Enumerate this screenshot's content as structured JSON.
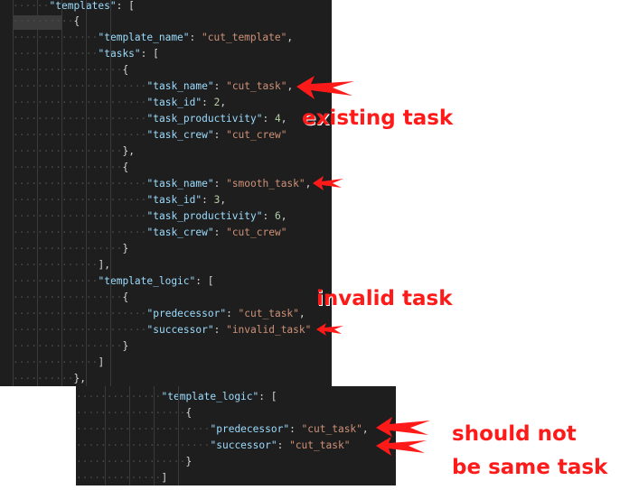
{
  "editor_top": {
    "lines": [
      [
        {
          "t": "\"templates\"",
          "c": "k"
        },
        {
          "t": ": [",
          "c": "p"
        }
      ],
      [
        {
          "t": "{",
          "c": "p"
        }
      ],
      [
        {
          "t": "\"template_name\"",
          "c": "k"
        },
        {
          "t": ": ",
          "c": "p"
        },
        {
          "t": "\"cut_template\"",
          "c": "s"
        },
        {
          "t": ",",
          "c": "p"
        }
      ],
      [
        {
          "t": "\"tasks\"",
          "c": "k"
        },
        {
          "t": ": [",
          "c": "p"
        }
      ],
      [
        {
          "t": "{",
          "c": "p"
        }
      ],
      [
        {
          "t": "\"task_name\"",
          "c": "k"
        },
        {
          "t": ": ",
          "c": "p"
        },
        {
          "t": "\"cut_task\"",
          "c": "s"
        },
        {
          "t": ",",
          "c": "p"
        }
      ],
      [
        {
          "t": "\"task_id\"",
          "c": "k"
        },
        {
          "t": ": ",
          "c": "p"
        },
        {
          "t": "2",
          "c": "n"
        },
        {
          "t": ",",
          "c": "p"
        }
      ],
      [
        {
          "t": "\"task_productivity\"",
          "c": "k"
        },
        {
          "t": ": ",
          "c": "p"
        },
        {
          "t": "4",
          "c": "n"
        },
        {
          "t": ",",
          "c": "p"
        }
      ],
      [
        {
          "t": "\"task_crew\"",
          "c": "k"
        },
        {
          "t": ": ",
          "c": "p"
        },
        {
          "t": "\"cut_crew\"",
          "c": "s"
        }
      ],
      [
        {
          "t": "},",
          "c": "p"
        }
      ],
      [
        {
          "t": "{",
          "c": "p"
        }
      ],
      [
        {
          "t": "\"task_name\"",
          "c": "k"
        },
        {
          "t": ": ",
          "c": "p"
        },
        {
          "t": "\"smooth_task\"",
          "c": "s"
        },
        {
          "t": ",",
          "c": "p"
        }
      ],
      [
        {
          "t": "\"task_id\"",
          "c": "k"
        },
        {
          "t": ": ",
          "c": "p"
        },
        {
          "t": "3",
          "c": "n"
        },
        {
          "t": ",",
          "c": "p"
        }
      ],
      [
        {
          "t": "\"task_productivity\"",
          "c": "k"
        },
        {
          "t": ": ",
          "c": "p"
        },
        {
          "t": "6",
          "c": "n"
        },
        {
          "t": ",",
          "c": "p"
        }
      ],
      [
        {
          "t": "\"task_crew\"",
          "c": "k"
        },
        {
          "t": ": ",
          "c": "p"
        },
        {
          "t": "\"cut_crew\"",
          "c": "s"
        }
      ],
      [
        {
          "t": "}",
          "c": "p"
        }
      ],
      [
        {
          "t": "],",
          "c": "p"
        }
      ],
      [
        {
          "t": "\"template_logic\"",
          "c": "k"
        },
        {
          "t": ": [",
          "c": "p"
        }
      ],
      [
        {
          "t": "{",
          "c": "p"
        }
      ],
      [
        {
          "t": "\"predecessor\"",
          "c": "k"
        },
        {
          "t": ": ",
          "c": "p"
        },
        {
          "t": "\"cut_task\"",
          "c": "s"
        },
        {
          "t": ",",
          "c": "p"
        }
      ],
      [
        {
          "t": "\"successor\"",
          "c": "k"
        },
        {
          "t": ": ",
          "c": "p"
        },
        {
          "t": "\"invalid_task\"",
          "c": "s"
        }
      ],
      [
        {
          "t": "}",
          "c": "p"
        }
      ],
      [
        {
          "t": "]",
          "c": "p"
        }
      ],
      [
        {
          "t": "},",
          "c": "p"
        }
      ]
    ]
  },
  "editor_bottom": {
    "lines": [
      [
        {
          "t": "\"template_logic\"",
          "c": "k"
        },
        {
          "t": ": [",
          "c": "p"
        }
      ],
      [
        {
          "t": "{",
          "c": "p"
        }
      ],
      [
        {
          "t": "\"predecessor\"",
          "c": "k"
        },
        {
          "t": ": ",
          "c": "p"
        },
        {
          "t": "\"cut_task\"",
          "c": "s"
        },
        {
          "t": ",",
          "c": "p"
        }
      ],
      [
        {
          "t": "\"successor\"",
          "c": "k"
        },
        {
          "t": ": ",
          "c": "p"
        },
        {
          "t": "\"cut_task\"",
          "c": "s"
        }
      ],
      [
        {
          "t": "}",
          "c": "p"
        }
      ],
      [
        {
          "t": "]",
          "c": "p"
        }
      ]
    ]
  },
  "annotations": {
    "existing": "existing task",
    "invalid": "invalid task",
    "same_line1": "should not",
    "same_line2": "be same task"
  },
  "colors": {
    "editor_bg": "#1e1e1e",
    "key": "#9cdcfe",
    "string": "#ce9178",
    "number": "#b5cea8",
    "annotation": "#ff1a1a"
  },
  "icons": [
    "arrow-icon"
  ]
}
